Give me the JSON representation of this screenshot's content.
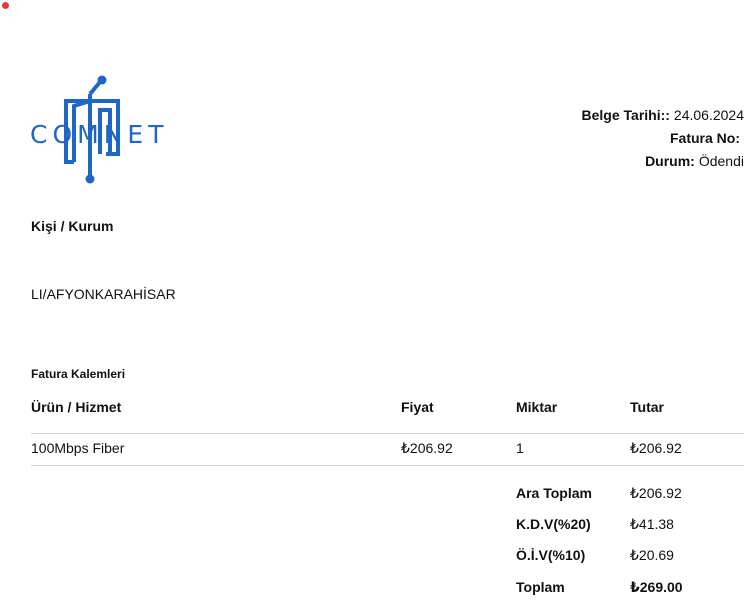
{
  "brand": {
    "logo_text": "COMNET",
    "logo_color": "#1e66c8"
  },
  "meta": {
    "date_label": "Belge Tarihi::",
    "date_value": "24.06.2024",
    "invoice_no_label": "Fatura No:",
    "invoice_no_value": "",
    "status_label": "Durum:",
    "status_value": "Ödendi"
  },
  "party": {
    "title": "Kişi / Kurum",
    "city": "LI/AFYONKARAHİSAR"
  },
  "items": {
    "title": "Fatura Kalemleri",
    "headers": [
      "Ürün / Hizmet",
      "Fiyat",
      "Miktar",
      "Tutar"
    ],
    "rows": [
      {
        "product": "100Mbps Fiber",
        "price": "₺206.92",
        "qty": "1",
        "total": "₺206.92"
      }
    ]
  },
  "summary": {
    "subtotal_label": "Ara Toplam",
    "subtotal_value": "₺206.92",
    "vat_label": "K.D.V(%20)",
    "vat_value": "₺41.38",
    "oiv_label": "Ö.İ.V(%10)",
    "oiv_value": "₺20.69",
    "total_label": "Toplam",
    "total_value": "₺269.00"
  }
}
